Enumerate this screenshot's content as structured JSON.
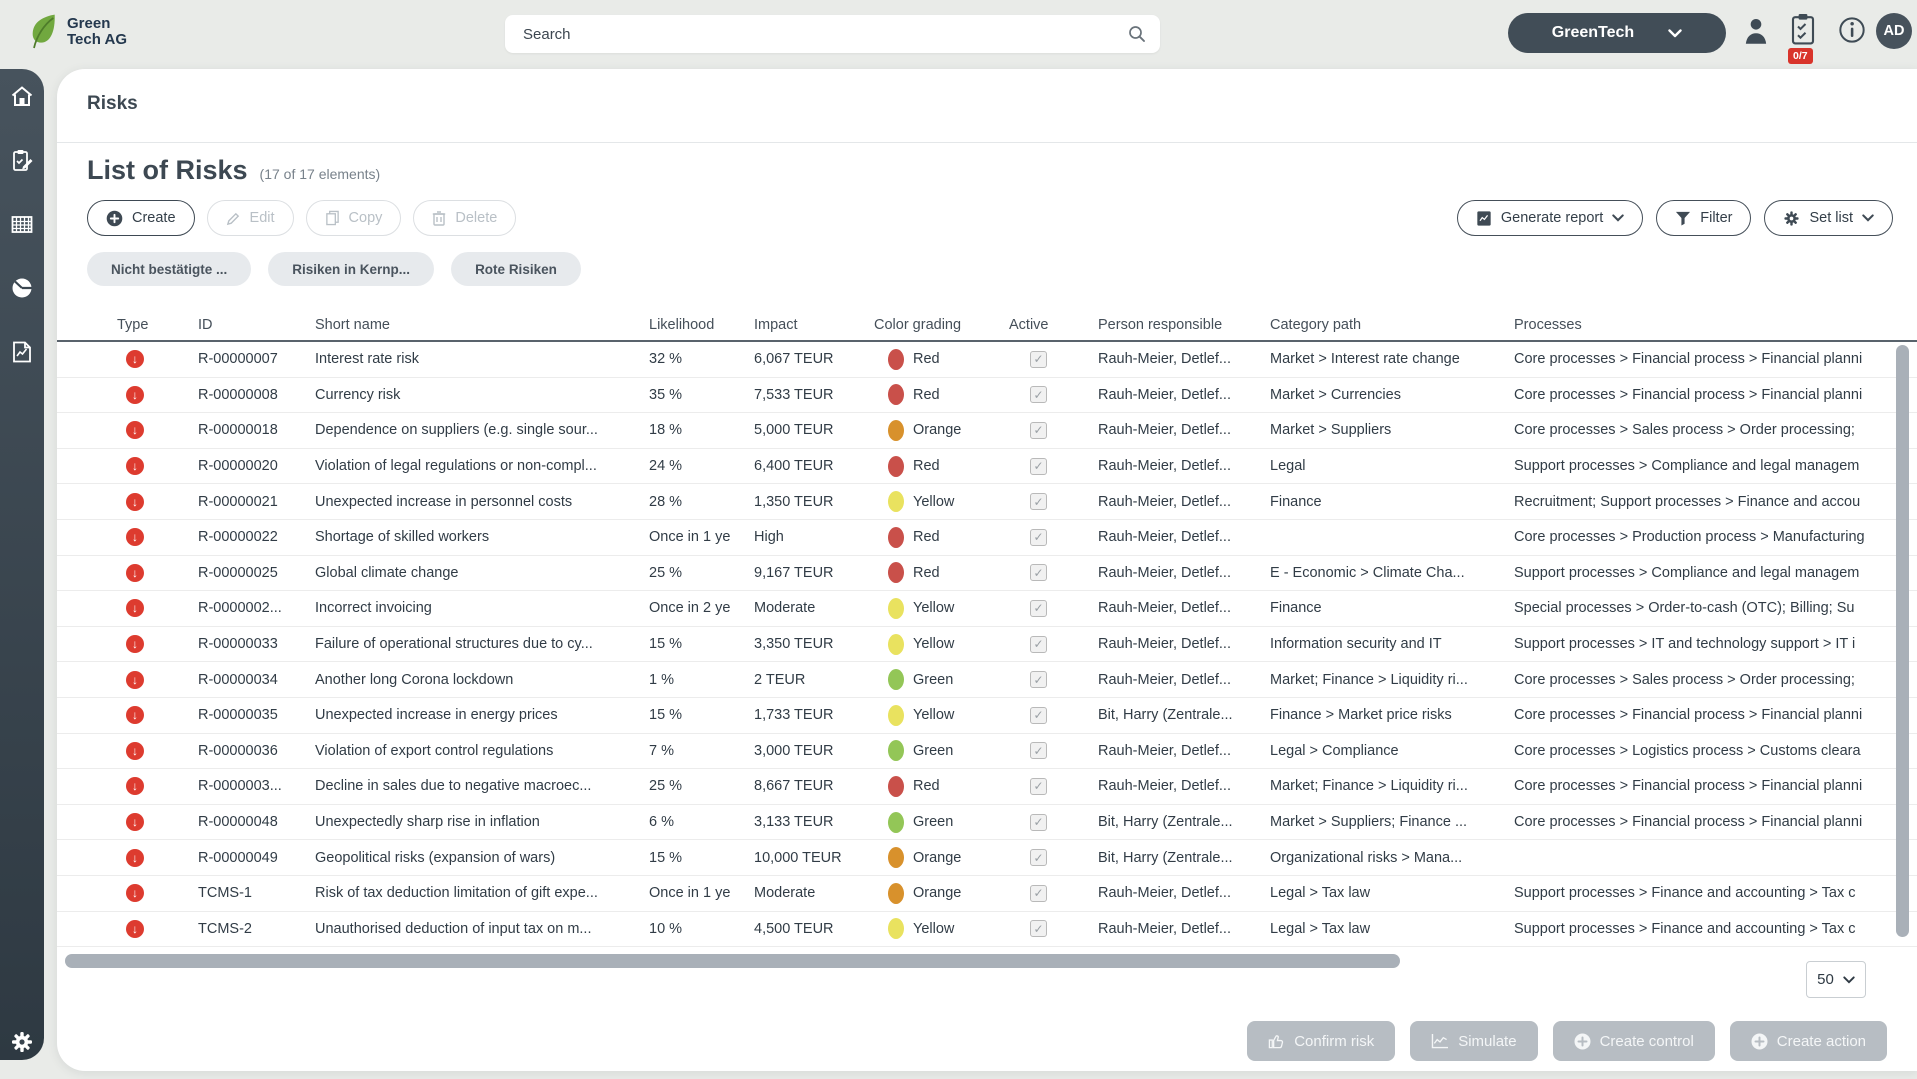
{
  "brand": {
    "line1": "Green",
    "line2": "Tech AG"
  },
  "header": {
    "search_placeholder": "Search",
    "org_selector_label": "GreenTech",
    "task_badge": "0/7",
    "avatar_initials": "AD",
    "icons": [
      "user-icon",
      "tasks-clipboard-icon",
      "info-icon"
    ]
  },
  "sidebar": {
    "icons": [
      "home-icon",
      "tasks-icon",
      "table-icon",
      "pie-chart-icon",
      "report-icon",
      "settings-gear-icon"
    ]
  },
  "breadcrumb": "Risks",
  "list": {
    "title": "List of Risks",
    "count_label": "(17 of 17 elements)"
  },
  "toolbar": {
    "create": "Create",
    "edit": "Edit",
    "copy": "Copy",
    "delete": "Delete",
    "generate_report": "Generate report",
    "filter": "Filter",
    "set_list": "Set list"
  },
  "chips": [
    "Nicht bestätigte ...",
    "Risiken in Kernp...",
    "Rote Risiken"
  ],
  "colors": {
    "Red": "#c9504a",
    "Orange": "#d8912c",
    "Yellow": "#e9e25f",
    "Green": "#93c657",
    "type_icon": "#dd3b2f",
    "brand_green": "#71a83f",
    "brand_navy": "#24384e",
    "badge_red": "#d9342b"
  },
  "table": {
    "columns": [
      "Type",
      "ID",
      "Short name",
      "Likelihood",
      "Impact",
      "Color grading",
      "Active",
      "Person responsible",
      "Category path",
      "Processes"
    ],
    "rows": [
      {
        "id": "R-00000007",
        "short_name": "Interest rate risk",
        "likelihood": "32 %",
        "impact": "6,067 TEUR",
        "grading": "Red",
        "person": "Rauh-Meier, Detlef...",
        "category": "Market > Interest rate change",
        "processes": "Core processes > Financial process > Financial planni"
      },
      {
        "id": "R-00000008",
        "short_name": "Currency risk",
        "likelihood": "35 %",
        "impact": "7,533 TEUR",
        "grading": "Red",
        "person": "Rauh-Meier, Detlef...",
        "category": "Market > Currencies",
        "processes": "Core processes > Financial process > Financial planni"
      },
      {
        "id": "R-00000018",
        "short_name": "Dependence on suppliers (e.g. single sour...",
        "likelihood": "18 %",
        "impact": "5,000 TEUR",
        "grading": "Orange",
        "person": "Rauh-Meier, Detlef...",
        "category": "Market > Suppliers",
        "processes": "Core processes > Sales process > Order processing;"
      },
      {
        "id": "R-00000020",
        "short_name": "Violation of legal regulations or non-compl...",
        "likelihood": "24 %",
        "impact": "6,400 TEUR",
        "grading": "Red",
        "person": "Rauh-Meier, Detlef...",
        "category": "Legal",
        "processes": "Support processes > Compliance and legal managem"
      },
      {
        "id": "R-00000021",
        "short_name": "Unexpected increase in personnel costs",
        "likelihood": "28 %",
        "impact": "1,350 TEUR",
        "grading": "Yellow",
        "person": "Rauh-Meier, Detlef...",
        "category": "Finance",
        "processes": "Recruitment; Support processes > Finance and accou"
      },
      {
        "id": "R-00000022",
        "short_name": "Shortage of skilled workers",
        "likelihood": "Once in 1 ye",
        "impact": "High",
        "grading": "Red",
        "person": "Rauh-Meier, Detlef...",
        "category": "",
        "processes": "Core processes > Production process > Manufacturing"
      },
      {
        "id": "R-00000025",
        "short_name": "Global climate change",
        "likelihood": "25 %",
        "impact": "9,167 TEUR",
        "grading": "Red",
        "person": "Rauh-Meier, Detlef...",
        "category": "E - Economic > Climate Cha...",
        "processes": "Support processes > Compliance and legal managem"
      },
      {
        "id": "R-0000002...",
        "short_name": "Incorrect invoicing",
        "likelihood": "Once in 2 ye",
        "impact": "Moderate",
        "grading": "Yellow",
        "person": "Rauh-Meier, Detlef...",
        "category": "Finance",
        "processes": "Special processes > Order-to-cash (OTC); Billing; Su"
      },
      {
        "id": "R-00000033",
        "short_name": "Failure of operational structures due to cy...",
        "likelihood": "15 %",
        "impact": "3,350 TEUR",
        "grading": "Yellow",
        "person": "Rauh-Meier, Detlef...",
        "category": "Information security and IT",
        "processes": "Support processes > IT and technology support > IT i"
      },
      {
        "id": "R-00000034",
        "short_name": "Another long Corona lockdown",
        "likelihood": "1 %",
        "impact": "2 TEUR",
        "grading": "Green",
        "person": "Rauh-Meier, Detlef...",
        "category": "Market; Finance > Liquidity ri...",
        "processes": "Core processes > Sales process > Order processing;"
      },
      {
        "id": "R-00000035",
        "short_name": "Unexpected increase in energy prices",
        "likelihood": "15 %",
        "impact": "1,733 TEUR",
        "grading": "Yellow",
        "person": "Bit, Harry (Zentrale...",
        "category": "Finance > Market price risks",
        "processes": "Core processes > Financial process > Financial planni"
      },
      {
        "id": "R-00000036",
        "short_name": "Violation of export control regulations",
        "likelihood": "7 %",
        "impact": "3,000 TEUR",
        "grading": "Green",
        "person": "Rauh-Meier, Detlef...",
        "category": "Legal > Compliance",
        "processes": "Core processes > Logistics process > Customs cleara"
      },
      {
        "id": "R-0000003...",
        "short_name": "Decline in sales due to negative macroec...",
        "likelihood": "25 %",
        "impact": "8,667 TEUR",
        "grading": "Red",
        "person": "Rauh-Meier, Detlef...",
        "category": "Market; Finance > Liquidity ri...",
        "processes": "Core processes > Financial process > Financial planni"
      },
      {
        "id": "R-00000048",
        "short_name": "Unexpectedly sharp rise in inflation",
        "likelihood": "6 %",
        "impact": "3,133 TEUR",
        "grading": "Green",
        "person": "Bit, Harry (Zentrale...",
        "category": "Market > Suppliers; Finance ...",
        "processes": "Core processes > Financial process > Financial planni"
      },
      {
        "id": "R-00000049",
        "short_name": "Geopolitical risks (expansion of wars)",
        "likelihood": "15 %",
        "impact": "10,000 TEUR",
        "grading": "Orange",
        "person": "Bit, Harry (Zentrale...",
        "category": "Organizational risks > Mana...",
        "processes": ""
      },
      {
        "id": "TCMS-1",
        "short_name": "Risk of tax deduction limitation of gift expe...",
        "likelihood": "Once in 1 ye",
        "impact": "Moderate",
        "grading": "Orange",
        "person": "Rauh-Meier, Detlef...",
        "category": "Legal > Tax law",
        "processes": "Support processes > Finance and accounting > Tax c"
      },
      {
        "id": "TCMS-2",
        "short_name": "Unauthorised deduction of input tax on m...",
        "likelihood": "10 %",
        "impact": "4,500 TEUR",
        "grading": "Yellow",
        "person": "Rauh-Meier, Detlef...",
        "category": "Legal > Tax law",
        "processes": "Support processes > Finance and accounting > Tax c"
      }
    ]
  },
  "footer": {
    "page_size": "50",
    "confirm_risk": "Confirm risk",
    "simulate": "Simulate",
    "create_control": "Create control",
    "create_action": "Create action"
  }
}
